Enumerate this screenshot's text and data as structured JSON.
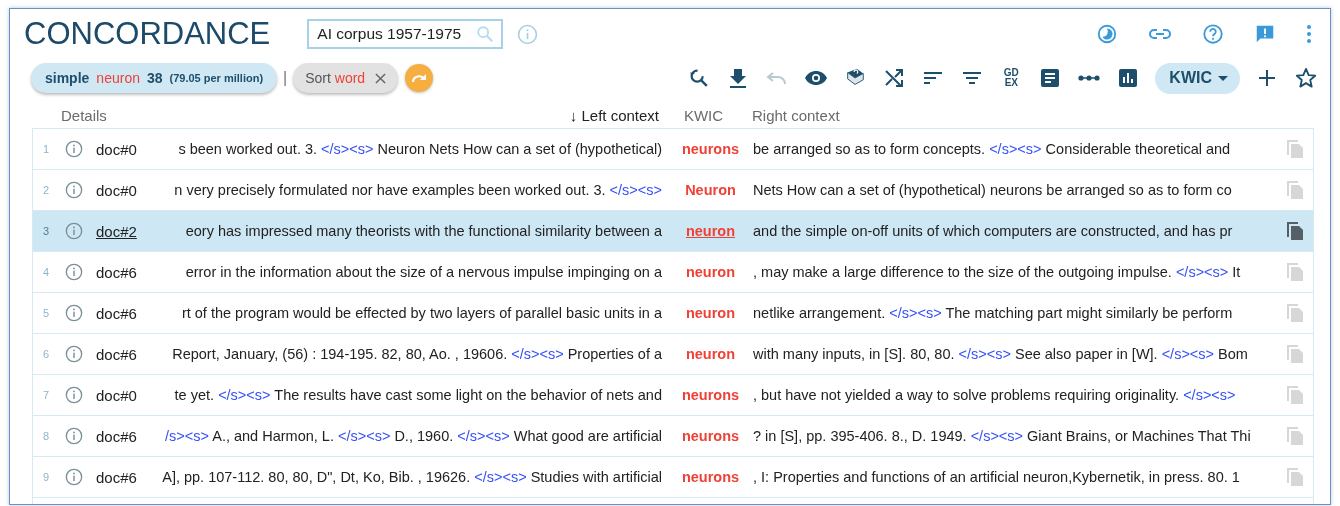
{
  "title": "CONCORDANCE",
  "corpus_field": {
    "value": "AI corpus 1957-1975"
  },
  "top_actions": [
    {
      "kind": "theme"
    },
    {
      "kind": "link"
    },
    {
      "kind": "help"
    },
    {
      "kind": "feedback"
    },
    {
      "kind": "more"
    }
  ],
  "query": {
    "type": "simple",
    "word": "neuron",
    "count": "38",
    "frequency": "(79.05 per million)"
  },
  "separator": "|",
  "sort_chip": {
    "label": "Sort",
    "value": "word"
  },
  "toolbar": [
    {
      "kind": "search",
      "disabled": false
    },
    {
      "kind": "download",
      "disabled": false
    },
    {
      "kind": "undo",
      "disabled": true
    },
    {
      "kind": "eye",
      "disabled": false
    },
    {
      "kind": "book",
      "disabled": false
    },
    {
      "kind": "shuffle",
      "disabled": false
    },
    {
      "kind": "sort",
      "disabled": false
    },
    {
      "kind": "filter",
      "disabled": false
    },
    {
      "kind": "gdex",
      "label": "GD EX",
      "disabled": false
    },
    {
      "kind": "document",
      "disabled": false
    },
    {
      "kind": "dots",
      "disabled": false
    },
    {
      "kind": "chart",
      "disabled": false
    },
    {
      "kind": "view",
      "label": "KWIC",
      "disabled": false
    },
    {
      "kind": "plus",
      "disabled": false
    },
    {
      "kind": "star",
      "disabled": false
    }
  ],
  "columns": [
    {
      "label": "Details"
    },
    {
      "label": "Left context",
      "sort_arrow": "↓"
    },
    {
      "label": "KWIC"
    },
    {
      "label": "Right context"
    }
  ],
  "rows": [
    {
      "number": "1",
      "doc": "doc#0",
      "selected": false,
      "left": [
        {
          "kind": "text",
          "text": "s been worked out. 3. "
        },
        {
          "kind": "tag",
          "text": "</s><s>"
        },
        {
          "kind": "text",
          "text": " Neuron Nets How can a set of (hypothetical)"
        }
      ],
      "kwic": "neurons",
      "right": [
        {
          "kind": "text",
          "text": "be arranged so as to form concepts. "
        },
        {
          "kind": "tag",
          "text": "</s><s>"
        },
        {
          "kind": "text",
          "text": " Considerable theoretical and"
        }
      ]
    },
    {
      "number": "2",
      "doc": "doc#0",
      "selected": false,
      "left": [
        {
          "kind": "text",
          "text": "n very precisely formulated nor have examples been worked out. 3. "
        },
        {
          "kind": "tag",
          "text": "</s><s>"
        }
      ],
      "kwic": "Neuron",
      "right": [
        {
          "kind": "text",
          "text": "Nets How can a set of (hypothetical) neurons be arranged so as to form co"
        }
      ]
    },
    {
      "number": "3",
      "doc": "doc#2",
      "selected": true,
      "left": [
        {
          "kind": "text",
          "text": "eory has impressed many theorists with the functional similarity between a"
        }
      ],
      "kwic": "neuron",
      "right": [
        {
          "kind": "text",
          "text": "and the simple on-off units of which computers are constructed, and has pr"
        }
      ]
    },
    {
      "number": "4",
      "doc": "doc#6",
      "selected": false,
      "left": [
        {
          "kind": "text",
          "text": "error in the information about the size of a nervous impulse impinging on a"
        }
      ],
      "kwic": "neuron",
      "right": [
        {
          "kind": "text",
          "text": ", may make a large difference to the size of the outgoing impulse. "
        },
        {
          "kind": "tag",
          "text": "</s><s>"
        },
        {
          "kind": "text",
          "text": " It"
        }
      ]
    },
    {
      "number": "5",
      "doc": "doc#6",
      "selected": false,
      "left": [
        {
          "kind": "text",
          "text": "rt of the program would be effected by two layers of parallel basic units in a"
        }
      ],
      "kwic": "neuron",
      "right": [
        {
          "kind": "text",
          "text": "netlike arrangement. "
        },
        {
          "kind": "tag",
          "text": "</s><s>"
        },
        {
          "kind": "text",
          "text": " The matching part might similarly be perform"
        }
      ]
    },
    {
      "number": "6",
      "doc": "doc#6",
      "selected": false,
      "left": [
        {
          "kind": "text",
          "text": "Report, January, (56) : 194-195. 82, 80, Ao. , 19606. "
        },
        {
          "kind": "tag",
          "text": "</s><s>"
        },
        {
          "kind": "text",
          "text": " Properties of a"
        }
      ],
      "kwic": "neuron",
      "right": [
        {
          "kind": "text",
          "text": "with many inputs, in [S]. 80, 80. "
        },
        {
          "kind": "tag",
          "text": "</s><s>"
        },
        {
          "kind": "text",
          "text": " See also paper in [W]. "
        },
        {
          "kind": "tag",
          "text": "</s><s>"
        },
        {
          "kind": "text",
          "text": " Bom"
        }
      ]
    },
    {
      "number": "7",
      "doc": "doc#0",
      "selected": false,
      "left": [
        {
          "kind": "text",
          "text": "te yet. "
        },
        {
          "kind": "tag",
          "text": "</s><s>"
        },
        {
          "kind": "text",
          "text": " The results have cast some light on the behavior of nets and"
        }
      ],
      "kwic": "neurons",
      "right": [
        {
          "kind": "text",
          "text": ", but have not yielded a way to solve problems requiring originality. "
        },
        {
          "kind": "tag",
          "text": "</s><s>"
        }
      ]
    },
    {
      "number": "8",
      "doc": "doc#6",
      "selected": false,
      "left": [
        {
          "kind": "tag",
          "text": "/s><s>"
        },
        {
          "kind": "text",
          "text": " A., and Harmon, L. "
        },
        {
          "kind": "tag",
          "text": "</s><s>"
        },
        {
          "kind": "text",
          "text": " D., 1960. "
        },
        {
          "kind": "tag",
          "text": "</s><s>"
        },
        {
          "kind": "text",
          "text": " What good are artificial"
        }
      ],
      "kwic": "neurons",
      "right": [
        {
          "kind": "text",
          "text": "? in [S], pp. 395-406. 8., D. 1949. "
        },
        {
          "kind": "tag",
          "text": "</s><s>"
        },
        {
          "kind": "text",
          "text": " Giant Brains, or Machines That Thi"
        }
      ]
    },
    {
      "number": "9",
      "doc": "doc#6",
      "selected": false,
      "left": [
        {
          "kind": "text",
          "text": "A], pp. 107-112. 80, 80, D\", Dt, Ko, Bib. , 19626. "
        },
        {
          "kind": "tag",
          "text": "</s><s>"
        },
        {
          "kind": "text",
          "text": " Studies with artificial"
        }
      ],
      "kwic": "neurons",
      "right": [
        {
          "kind": "text",
          "text": ", I: Properties and functions of an artificial neuron,Kybernetik, in press. 80. 1"
        }
      ]
    }
  ]
}
